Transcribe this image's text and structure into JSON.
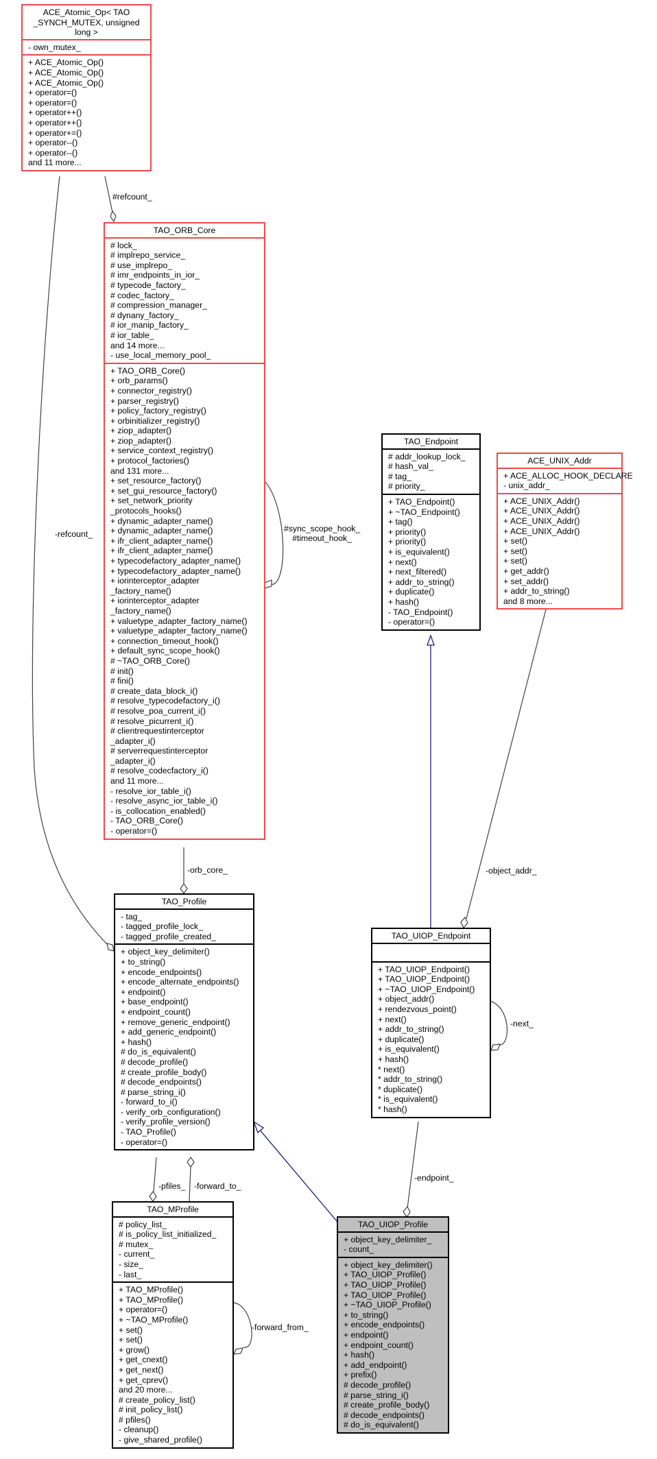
{
  "diagram": {
    "type": "uml-collaboration-diagram",
    "subject": "TAO_UIOP_Profile"
  },
  "nodes": {
    "ace_atomic_op": {
      "title_lines": [
        "ACE_Atomic_Op< TAO",
        "_SYNCH_MUTEX, unsigned",
        "long >"
      ],
      "attributes": [
        "- own_mutex_"
      ],
      "methods": [
        "+ ACE_Atomic_Op()",
        "+ ACE_Atomic_Op()",
        "+ ACE_Atomic_Op()",
        "+ operator=()",
        "+ operator=()",
        "+ operator++()",
        "+ operator++()",
        "+ operator+=()",
        "+ operator--()",
        "+ operator--()",
        "and 11 more..."
      ],
      "border_color": "#f04848"
    },
    "tao_orb_core": {
      "title_lines": [
        "TAO_ORB_Core"
      ],
      "attributes": [
        "# lock_",
        "# implrepo_service_",
        "# use_implrepo_",
        "# imr_endpoints_in_ior_",
        "# typecode_factory_",
        "# codec_factory_",
        "# compression_manager_",
        "# dynany_factory_",
        "# ior_manip_factory_",
        "# ior_table_",
        "and 14 more...",
        "- use_local_memory_pool_"
      ],
      "methods": [
        "+ TAO_ORB_Core()",
        "+ orb_params()",
        "+ connector_registry()",
        "+ parser_registry()",
        "+ policy_factory_registry()",
        "+ orbinitializer_registry()",
        "+ ziop_adapter()",
        "+ ziop_adapter()",
        "+ service_context_registry()",
        "+ protocol_factories()",
        "and 131 more...",
        "+ set_resource_factory()",
        "+ set_gui_resource_factory()",
        "+ set_network_priority",
        "_protocols_hooks()",
        "+ dynamic_adapter_name()",
        "+ dynamic_adapter_name()",
        "+ ifr_client_adapter_name()",
        "+ ifr_client_adapter_name()",
        "+ typecodefactory_adapter_name()",
        "+ typecodefactory_adapter_name()",
        "+ iorinterceptor_adapter",
        "_factory_name()",
        "+ iorinterceptor_adapter",
        "_factory_name()",
        "+ valuetype_adapter_factory_name()",
        "+ valuetype_adapter_factory_name()",
        "+ connection_timeout_hook()",
        "+ default_sync_scope_hook()",
        "# ~TAO_ORB_Core()",
        "# init()",
        "# fini()",
        "# create_data_block_i()",
        "# resolve_typecodefactory_i()",
        "# resolve_poa_current_i()",
        "# resolve_picurrent_i()",
        "# clientrequestinterceptor",
        "_adapter_i()",
        "# serverrequestinterceptor",
        "_adapter_i()",
        "# resolve_codecfactory_i()",
        "and 11 more...",
        "- resolve_ior_table_i()",
        "- resolve_async_ior_table_i()",
        "- is_collocation_enabled()",
        "- TAO_ORB_Core()",
        "- operator=()"
      ],
      "border_color": "#f04848"
    },
    "tao_endpoint": {
      "title_lines": [
        "TAO_Endpoint"
      ],
      "attributes": [
        "# addr_lookup_lock_",
        "# hash_val_",
        "# tag_",
        "# priority_"
      ],
      "methods": [
        "+ TAO_Endpoint()",
        "+ ~TAO_Endpoint()",
        "+ tag()",
        "+ priority()",
        "+ priority()",
        "+ is_equivalent()",
        "+ next()",
        "+ next_filtered()",
        "+ addr_to_string()",
        "+ duplicate()",
        "+ hash()",
        "- TAO_Endpoint()",
        "- operator=()"
      ],
      "border_color": "#000000"
    },
    "ace_unix_addr": {
      "title_lines": [
        "ACE_UNIX_Addr"
      ],
      "attributes": [
        "+ ACE_ALLOC_HOOK_DECLARE",
        "- unix_addr_"
      ],
      "methods": [
        "+ ACE_UNIX_Addr()",
        "+ ACE_UNIX_Addr()",
        "+ ACE_UNIX_Addr()",
        "+ ACE_UNIX_Addr()",
        "+ set()",
        "+ set()",
        "+ set()",
        "+ get_addr()",
        "+ set_addr()",
        "+ addr_to_string()",
        "and 8 more..."
      ],
      "border_color": "#f04848"
    },
    "tao_profile": {
      "title_lines": [
        "TAO_Profile"
      ],
      "attributes": [
        "- tag_",
        "- tagged_profile_lock_",
        "- tagged_profile_created_"
      ],
      "methods": [
        "+ object_key_delimiter()",
        "+ to_string()",
        "+ encode_endpoints()",
        "+ encode_alternate_endpoints()",
        "+ endpoint()",
        "+ base_endpoint()",
        "+ endpoint_count()",
        "+ remove_generic_endpoint()",
        "+ add_generic_endpoint()",
        "+ hash()",
        "# do_is_equivalent()",
        "# decode_profile()",
        "# create_profile_body()",
        "# decode_endpoints()",
        "# parse_string_i()",
        "- forward_to_i()",
        "- verify_orb_configuration()",
        "- verify_profile_version()",
        "- TAO_Profile()",
        "- operator=()"
      ],
      "border_color": "#000000"
    },
    "tao_uiop_endpoint": {
      "title_lines": [
        "TAO_UIOP_Endpoint"
      ],
      "attributes": [],
      "methods": [
        "+ TAO_UIOP_Endpoint()",
        "+ TAO_UIOP_Endpoint()",
        "+ ~TAO_UIOP_Endpoint()",
        "+ object_addr()",
        "+ rendezvous_point()",
        "+ next()",
        "+ addr_to_string()",
        "+ duplicate()",
        "+ is_equivalent()",
        "+ hash()",
        "* next()",
        "* addr_to_string()",
        "* duplicate()",
        "* is_equivalent()",
        "* hash()"
      ],
      "border_color": "#000000"
    },
    "tao_mprofile": {
      "title_lines": [
        "TAO_MProfile"
      ],
      "attributes": [
        "# policy_list_",
        "# is_policy_list_initialized_",
        "# mutex_",
        "- current_",
        "- size_",
        "- last_"
      ],
      "methods": [
        "+ TAO_MProfile()",
        "+ TAO_MProfile()",
        "+ operator=()",
        "+ ~TAO_MProfile()",
        "+ set()",
        "+ set()",
        "+ grow()",
        "+ get_cnext()",
        "+ get_next()",
        "+ get_cprev()",
        "and 20 more...",
        "# create_policy_list()",
        "# init_policy_list()",
        "# pfiles()",
        "- cleanup()",
        "- give_shared_profile()"
      ],
      "border_color": "#000000"
    },
    "tao_uiop_profile": {
      "title_lines": [
        "TAO_UIOP_Profile"
      ],
      "attributes": [
        "+ object_key_delimiter_",
        "- count_"
      ],
      "methods": [
        "+ object_key_delimiter()",
        "+ TAO_UIOP_Profile()",
        "+ TAO_UIOP_Profile()",
        "+ TAO_UIOP_Profile()",
        "+ ~TAO_UIOP_Profile()",
        "+ to_string()",
        "+ encode_endpoints()",
        "+ endpoint()",
        "+ endpoint_count()",
        "+ hash()",
        "+ add_endpoint()",
        "+ prefix()",
        "# decode_profile()",
        "# parse_string_i()",
        "# create_profile_body()",
        "# decode_endpoints()",
        "# do_is_equivalent()"
      ],
      "border_color": "#000000",
      "fill_color": "#bfbfbf",
      "highlighted": true
    }
  },
  "edges": [
    {
      "id": "refcount-protected",
      "from": "ace_atomic_op",
      "to": "tao_orb_core",
      "kind": "aggregation",
      "label": "#refcount_"
    },
    {
      "id": "refcount-private",
      "from": "ace_atomic_op",
      "to": "tao_profile",
      "kind": "aggregation",
      "label": "-refcount_"
    },
    {
      "id": "hooks",
      "from": "tao_orb_core",
      "to": "tao_orb_core",
      "kind": "aggregation",
      "label_lines": [
        "#sync_scope_hook_",
        "#timeout_hook_"
      ]
    },
    {
      "id": "orb-core",
      "from": "tao_orb_core",
      "to": "tao_profile",
      "kind": "aggregation",
      "label": "-orb_core_"
    },
    {
      "id": "pfiles",
      "from": "tao_profile",
      "to": "tao_mprofile",
      "kind": "aggregation",
      "label": "-pfiles_"
    },
    {
      "id": "forward-to",
      "from": "tao_mprofile",
      "to": "tao_profile",
      "kind": "aggregation",
      "label": "-forward_to_"
    },
    {
      "id": "forward-from",
      "from": "tao_mprofile",
      "to": "tao_mprofile",
      "kind": "aggregation",
      "label": "-forward_from_"
    },
    {
      "id": "profile-inherit",
      "from": "tao_uiop_profile",
      "to": "tao_profile",
      "kind": "inheritance",
      "color": "#1f1f7a"
    },
    {
      "id": "endpoint-inherit",
      "from": "tao_uiop_endpoint",
      "to": "tao_endpoint",
      "kind": "inheritance",
      "color": "#1f1f7a"
    },
    {
      "id": "object-addr",
      "from": "ace_unix_addr",
      "to": "tao_uiop_endpoint",
      "kind": "aggregation",
      "label": "-object_addr_"
    },
    {
      "id": "next",
      "from": "tao_uiop_endpoint",
      "to": "tao_uiop_endpoint",
      "kind": "aggregation",
      "label": "-next_"
    },
    {
      "id": "endpoint",
      "from": "tao_uiop_endpoint",
      "to": "tao_uiop_profile",
      "kind": "aggregation",
      "label": "-endpoint_"
    }
  ],
  "colors": {
    "edge": "#404040",
    "inheritance": "#1f1f7a",
    "external_class_border": "#f04848",
    "class_border": "#000000",
    "subject_fill": "#bfbfbf"
  }
}
